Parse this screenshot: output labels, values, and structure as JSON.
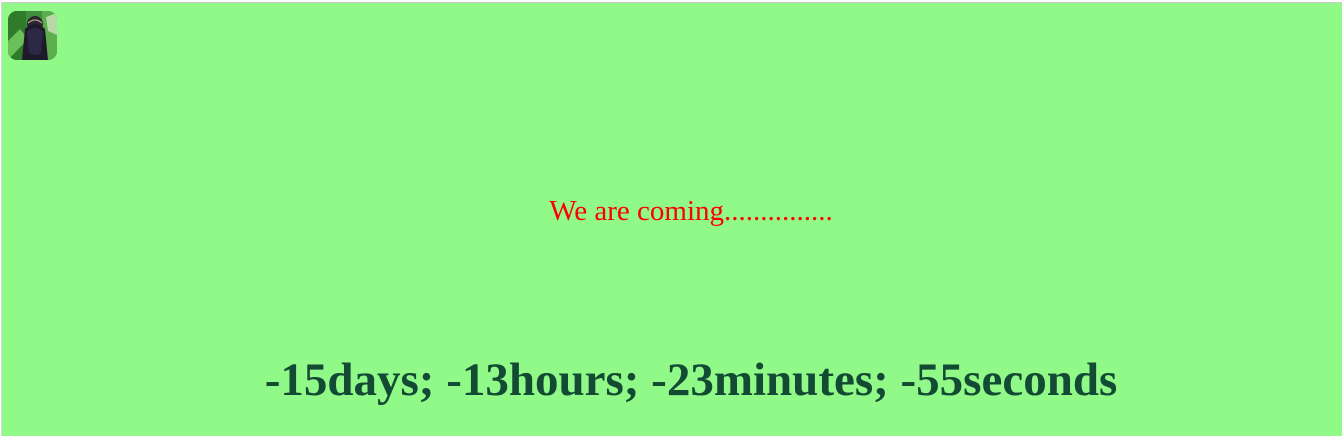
{
  "tagline": "We are coming...............",
  "countdown": "-15days; -13hours; -23minutes; -55seconds",
  "colors": {
    "background": "#90f987",
    "tagline": "#ff0000",
    "countdown": "#124a34"
  },
  "avatar": {
    "icon": "profile-photo-icon"
  }
}
